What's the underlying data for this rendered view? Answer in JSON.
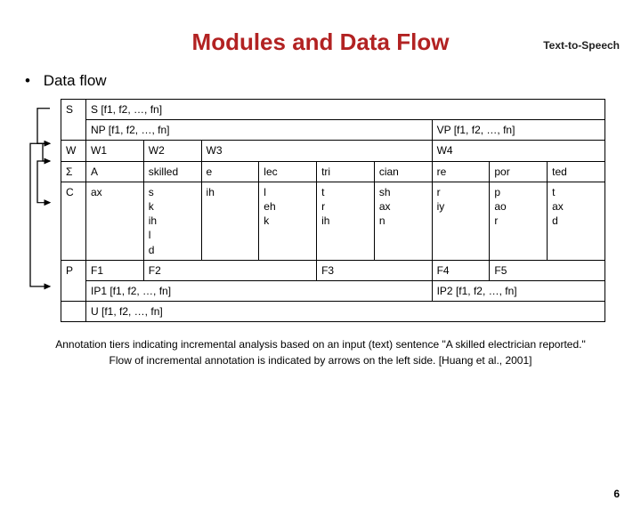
{
  "header": {
    "topic": "Text-to-Speech"
  },
  "title": "Modules and Data Flow",
  "bullet": {
    "dot": "•",
    "text": "Data flow"
  },
  "tiers": {
    "S": {
      "label": "S",
      "row1": "S [f1, f2, …, fn]",
      "row2_left": "NP [f1, f2, …, fn]",
      "row2_right": "VP [f1, f2, …, fn]"
    },
    "W": {
      "label": "W",
      "c1": "W1",
      "c2": "W2",
      "c3": "W3",
      "c4": "W4"
    },
    "Sg": {
      "label": "Σ",
      "c1": "A",
      "c2": "skilled",
      "c3": "e",
      "c4": "lec",
      "c5": "tri",
      "c6": "cian",
      "c7": "re",
      "c8": "por",
      "c9": "ted"
    },
    "C": {
      "label": "C",
      "c1": "ax",
      "c2": "s\nk\nih\nl\nd",
      "c3": "ih",
      "c4": "l\neh\nk",
      "c5": "t\nr\nih",
      "c6": "sh\nax\nn",
      "c7": "r\niy",
      "c8": "p\nao\nr",
      "c9": "t\nax\nd"
    },
    "F": {
      "c1": "F1",
      "c2": "F2",
      "c3": "F3",
      "c4": "F4",
      "c5": "F5"
    },
    "P": {
      "label": "P",
      "left": "IP1 [f1, f2, …, fn]",
      "right": "IP2 [f1, f2, …, fn]"
    },
    "U": {
      "row": "U [f1, f2, …, fn]"
    }
  },
  "caption": {
    "line1": "Annotation tiers indicating incremental analysis based on an input (text) sentence \"A skilled electrician reported.\"",
    "line2": "Flow of incremental annotation is indicated by arrows on the left side. [Huang et al., 2001]"
  },
  "pagenum": "6"
}
